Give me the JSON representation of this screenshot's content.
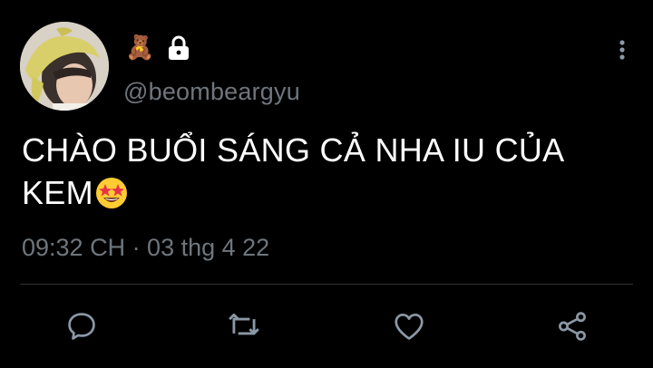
{
  "tweet": {
    "author": {
      "display_name_icons": [
        "teddy-bear-emoji",
        "lock-icon"
      ],
      "bear_emoji": "🧸",
      "handle": "@beombeargyu"
    },
    "text_line1": "CHÀO BUỔI SÁNG CẢ NHA IU CỦA",
    "text_line2": "KEM",
    "text_emoji": "star-struck-emoji",
    "timestamp": "09:32 CH · 03 thg 4 22"
  },
  "actions": [
    "reply-icon",
    "retweet-icon",
    "like-icon",
    "share-icon"
  ],
  "colors": {
    "background": "#000000",
    "text": "#ffffff",
    "secondary": "#6e767d",
    "divider": "#2f3336",
    "icon": "#8b98a5"
  }
}
